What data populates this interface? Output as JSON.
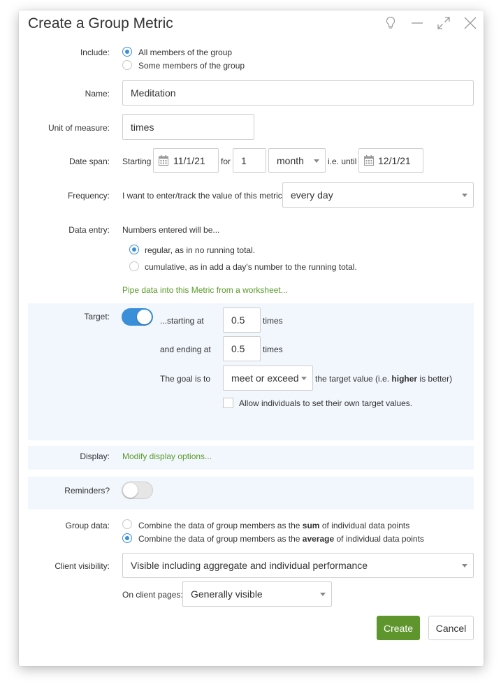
{
  "dialog": {
    "title": "Create a Group Metric",
    "controls": [
      "lightbulb-icon",
      "minimize-icon",
      "maximize-icon",
      "close-icon"
    ]
  },
  "include": {
    "label": "Include:",
    "options": [
      "All members of the group",
      "Some members of the group"
    ],
    "selected": 0
  },
  "name": {
    "label": "Name:",
    "value": "Meditation"
  },
  "unit": {
    "label": "Unit of measure:",
    "value": "times"
  },
  "date_span": {
    "label": "Date span:",
    "starting_label": "Starting",
    "start_date": "11/1/21",
    "for_label": "for",
    "count": "1",
    "period": "month",
    "until_label": "i.e. until",
    "end_date": "12/1/21"
  },
  "frequency": {
    "label": "Frequency:",
    "text": "I want to enter/track the value of this metric",
    "value": "every day"
  },
  "data_entry": {
    "label": "Data entry:",
    "intro": "Numbers entered will be...",
    "options": [
      "regular, as in no running total.",
      "cumulative, as in add a day's number to the running total."
    ],
    "selected": 0,
    "pipe_link": "Pipe data into this Metric from a worksheet..."
  },
  "target": {
    "label": "Target:",
    "enabled": true,
    "starting_label": "...starting at",
    "starting_value": "0.5",
    "starting_unit": "times",
    "ending_label": "and ending at",
    "ending_value": "0.5",
    "ending_unit": "times",
    "goal_label": "The goal is to",
    "goal_value": "meet or exceed",
    "goal_suffix_pre": "the target value (i.e. ",
    "goal_suffix_bold": "higher",
    "goal_suffix_post": " is better)",
    "allow_individuals": "Allow individuals to set their own target values."
  },
  "display": {
    "label": "Display:",
    "link": "Modify display options..."
  },
  "reminders": {
    "label": "Reminders?",
    "enabled": false
  },
  "group_data": {
    "label": "Group data:",
    "opt1_pre": "Combine the data of group members as the ",
    "opt1_bold": "sum",
    "opt1_post": " of individual data points",
    "opt2_pre": "Combine the data of group members as the ",
    "opt2_bold": "average",
    "opt2_post": " of individual data points",
    "selected": 1
  },
  "client_visibility": {
    "label": "Client visibility:",
    "value": "Visible including aggregate and individual performance",
    "client_pages_label": "On client pages:",
    "client_pages_value": "Generally visible"
  },
  "buttons": {
    "create": "Create",
    "cancel": "Cancel"
  },
  "colors": {
    "accent": "#3a8fd9",
    "link": "#5a9a2a",
    "primary": "#5e962d",
    "panel": "#f2f7fd"
  }
}
